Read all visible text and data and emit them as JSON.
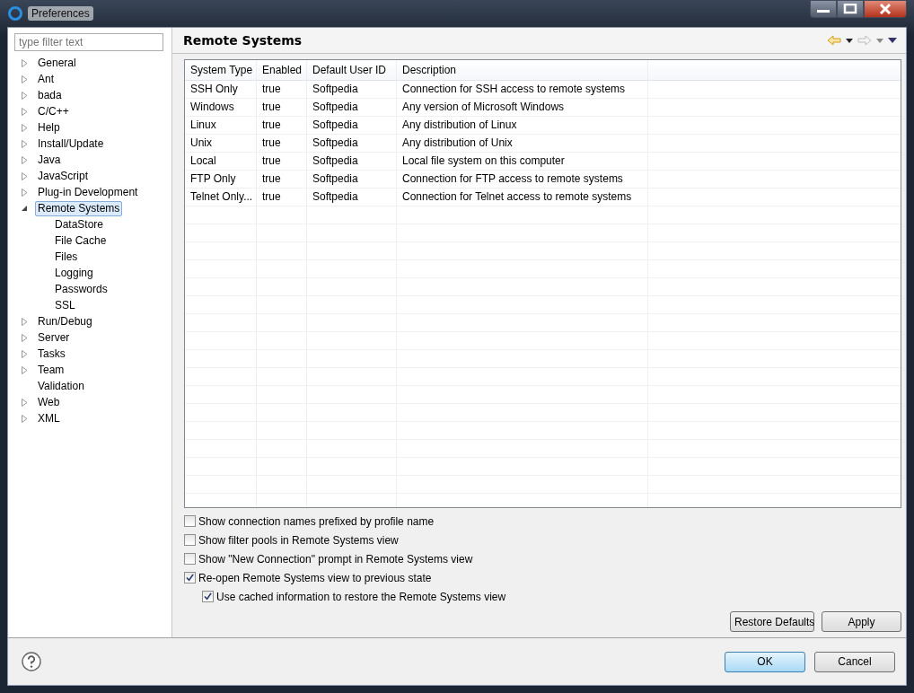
{
  "window": {
    "title": "Preferences"
  },
  "filter": {
    "placeholder": "type filter text"
  },
  "tree": [
    {
      "label": "General",
      "kind": "folder",
      "expanded": false,
      "selected": false
    },
    {
      "label": "Ant",
      "kind": "folder",
      "expanded": false,
      "selected": false
    },
    {
      "label": "bada",
      "kind": "folder",
      "expanded": false,
      "selected": false
    },
    {
      "label": "C/C++",
      "kind": "folder",
      "expanded": false,
      "selected": false
    },
    {
      "label": "Help",
      "kind": "folder",
      "expanded": false,
      "selected": false
    },
    {
      "label": "Install/Update",
      "kind": "folder",
      "expanded": false,
      "selected": false
    },
    {
      "label": "Java",
      "kind": "folder",
      "expanded": false,
      "selected": false
    },
    {
      "label": "JavaScript",
      "kind": "folder",
      "expanded": false,
      "selected": false
    },
    {
      "label": "Plug-in Development",
      "kind": "folder",
      "expanded": false,
      "selected": false
    },
    {
      "label": "Remote Systems",
      "kind": "folder",
      "expanded": true,
      "selected": true,
      "children": [
        {
          "label": "DataStore",
          "selected": false
        },
        {
          "label": "File Cache",
          "selected": false
        },
        {
          "label": "Files",
          "selected": false
        },
        {
          "label": "Logging",
          "selected": false
        },
        {
          "label": "Passwords",
          "selected": false
        },
        {
          "label": "SSL",
          "selected": false
        }
      ]
    },
    {
      "label": "Run/Debug",
      "kind": "folder",
      "expanded": false,
      "selected": false
    },
    {
      "label": "Server",
      "kind": "folder",
      "expanded": false,
      "selected": false
    },
    {
      "label": "Tasks",
      "kind": "folder",
      "expanded": false,
      "selected": false
    },
    {
      "label": "Team",
      "kind": "folder",
      "expanded": false,
      "selected": false
    },
    {
      "label": "Validation",
      "kind": "leaf",
      "selected": false
    },
    {
      "label": "Web",
      "kind": "folder",
      "expanded": false,
      "selected": false
    },
    {
      "label": "XML",
      "kind": "folder",
      "expanded": false,
      "selected": false
    }
  ],
  "page": {
    "title": "Remote Systems"
  },
  "table": {
    "columns": [
      "System Type",
      "Enabled",
      "Default User ID",
      "Description"
    ],
    "rows": [
      [
        "SSH Only",
        "true",
        "Softpedia",
        "Connection for SSH access to remote systems"
      ],
      [
        "Windows",
        "true",
        "Softpedia",
        "Any version of Microsoft Windows"
      ],
      [
        "Linux",
        "true",
        "Softpedia",
        "Any distribution of Linux"
      ],
      [
        "Unix",
        "true",
        "Softpedia",
        "Any distribution of Unix"
      ],
      [
        "Local",
        "true",
        "Softpedia",
        "Local file system on this computer"
      ],
      [
        "FTP Only",
        "true",
        "Softpedia",
        "Connection for FTP access to remote systems"
      ],
      [
        "Telnet Only...",
        "true",
        "Softpedia",
        "Connection for Telnet access to remote systems"
      ]
    ]
  },
  "options": [
    {
      "label": "Show connection names prefixed by profile name",
      "checked": false
    },
    {
      "label": "Show filter pools in Remote Systems view",
      "checked": false
    },
    {
      "label": "Show \"New Connection\" prompt in Remote Systems view",
      "checked": false
    },
    {
      "label": "Re-open Remote Systems view to previous state",
      "checked": true,
      "children": [
        {
          "label": "Use cached information to restore the Remote Systems view",
          "checked": true
        }
      ]
    }
  ],
  "page_buttons": [
    "Restore Defaults",
    "Apply"
  ],
  "dialog_buttons": [
    {
      "label": "OK",
      "default": true
    },
    {
      "label": "Cancel",
      "default": false
    }
  ]
}
